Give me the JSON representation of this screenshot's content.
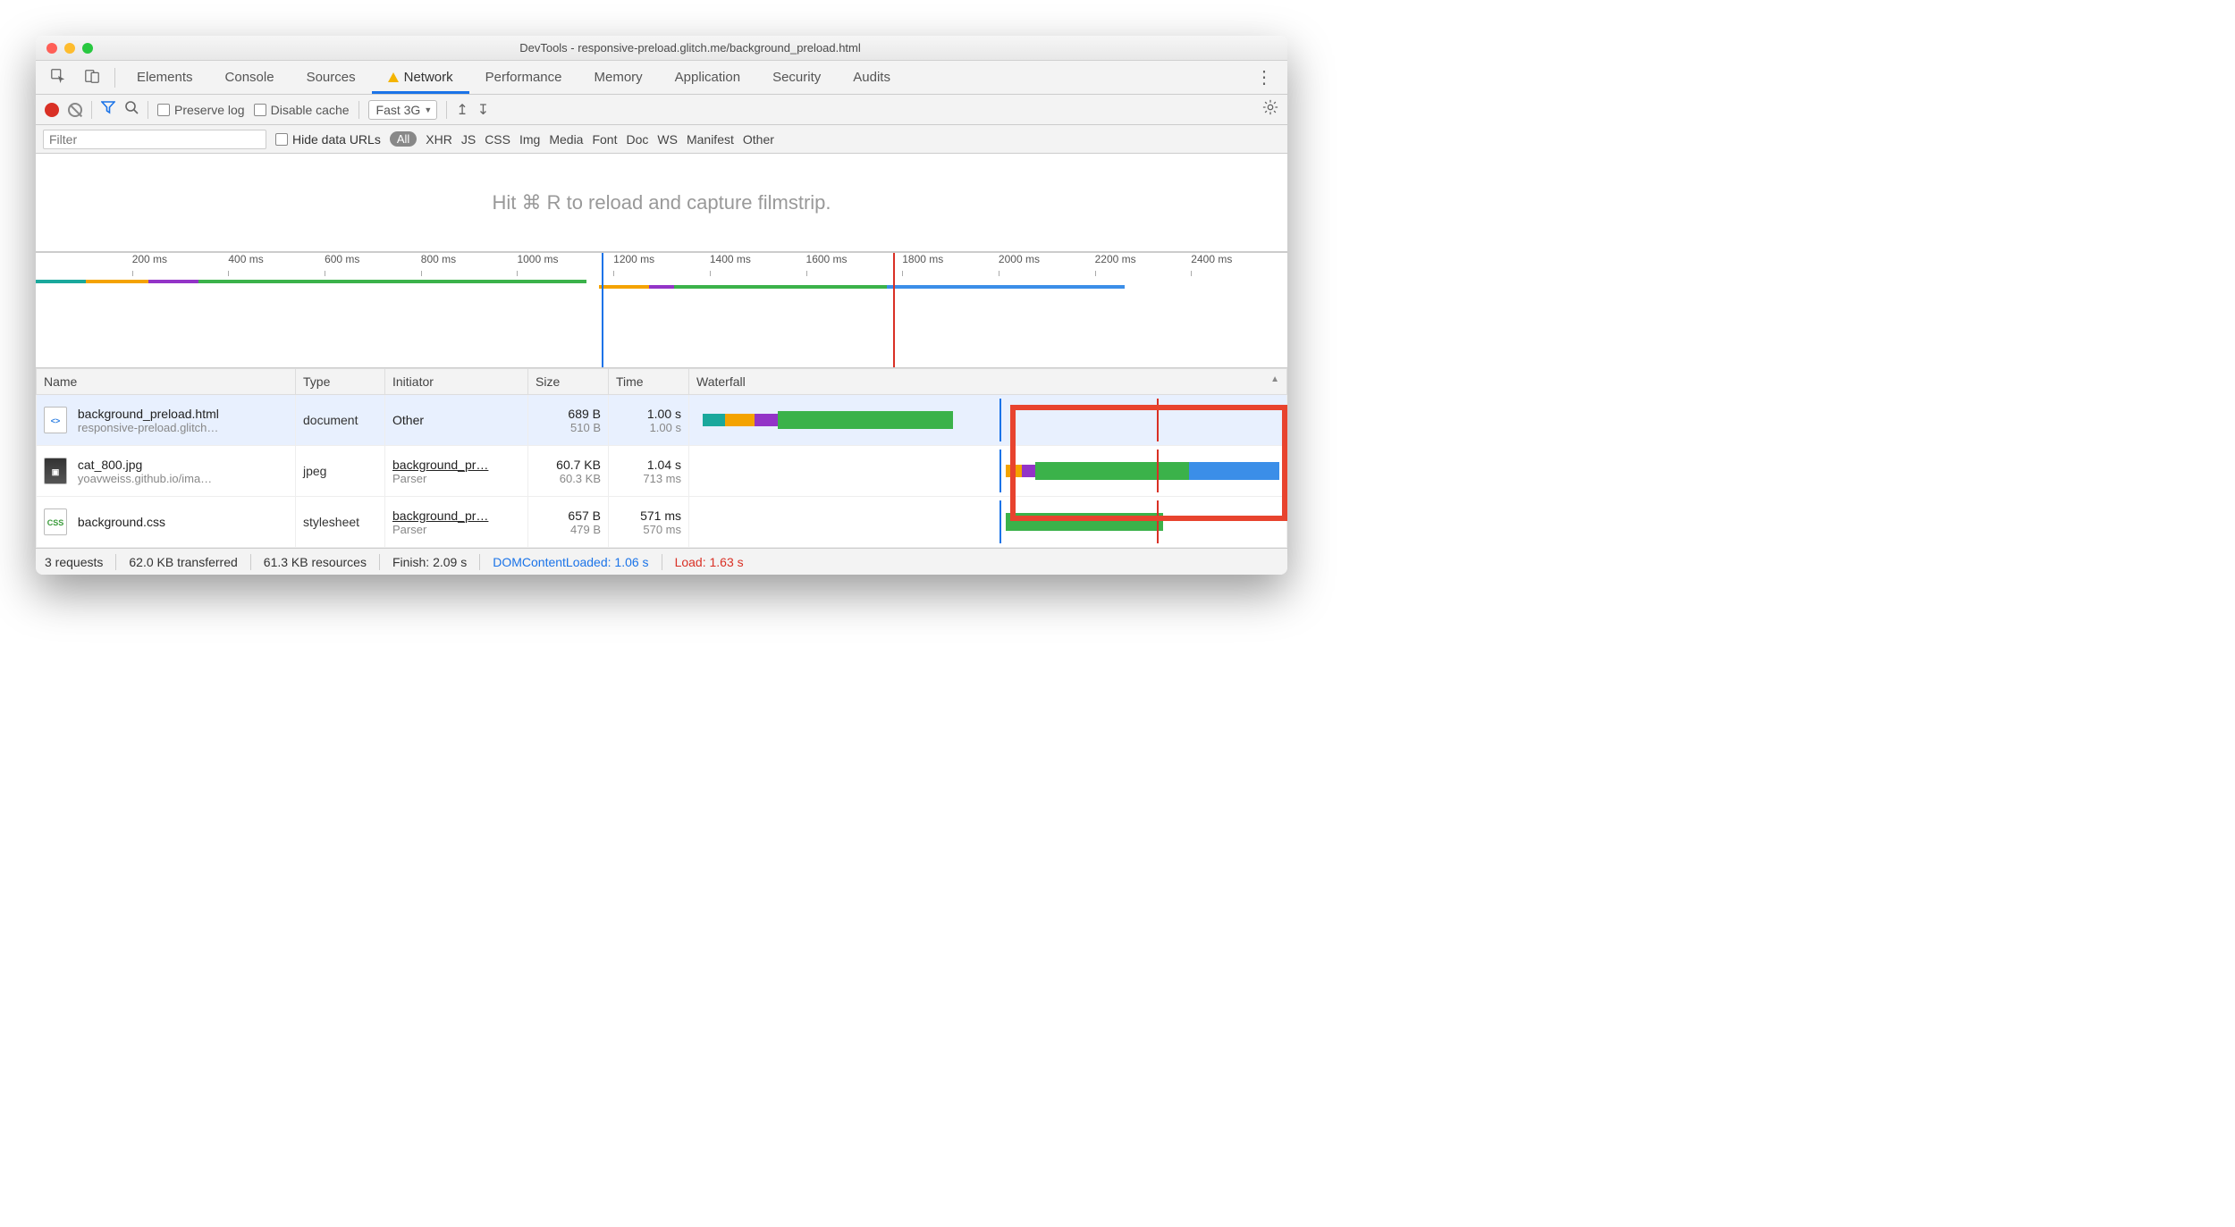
{
  "window": {
    "title": "DevTools - responsive-preload.glitch.me/background_preload.html"
  },
  "tabs": {
    "elements": "Elements",
    "console": "Console",
    "sources": "Sources",
    "network": "Network",
    "performance": "Performance",
    "memory": "Memory",
    "application": "Application",
    "security": "Security",
    "audits": "Audits"
  },
  "toolbar": {
    "preserve_log": "Preserve log",
    "disable_cache": "Disable cache",
    "throttle": "Fast 3G"
  },
  "filterbar": {
    "filter_placeholder": "Filter",
    "hide_urls": "Hide data URLs",
    "all": "All",
    "types": [
      "XHR",
      "JS",
      "CSS",
      "Img",
      "Media",
      "Font",
      "Doc",
      "WS",
      "Manifest",
      "Other"
    ]
  },
  "filmstrip": {
    "message": "Hit ⌘ R to reload and capture filmstrip."
  },
  "ruler": {
    "ticks": [
      "200 ms",
      "400 ms",
      "600 ms",
      "800 ms",
      "1000 ms",
      "1200 ms",
      "1400 ms",
      "1600 ms",
      "1800 ms",
      "2000 ms",
      "2200 ms",
      "2400 ms"
    ]
  },
  "columns": {
    "name": "Name",
    "type": "Type",
    "initiator": "Initiator",
    "size": "Size",
    "time": "Time",
    "waterfall": "Waterfall"
  },
  "rows": [
    {
      "name": "background_preload.html",
      "sub": "responsive-preload.glitch…",
      "type": "document",
      "initiator": "Other",
      "initiator_sub": "",
      "size": "689 B",
      "size_sub": "510 B",
      "time": "1.00 s",
      "time_sub": "1.00 s"
    },
    {
      "name": "cat_800.jpg",
      "sub": "yoavweiss.github.io/ima…",
      "type": "jpeg",
      "initiator": "background_pr…",
      "initiator_sub": "Parser",
      "size": "60.7 KB",
      "size_sub": "60.3 KB",
      "time": "1.04 s",
      "time_sub": "713 ms"
    },
    {
      "name": "background.css",
      "sub": "",
      "type": "stylesheet",
      "initiator": "background_pr…",
      "initiator_sub": "Parser",
      "size": "657 B",
      "size_sub": "479 B",
      "time": "571 ms",
      "time_sub": "570 ms"
    }
  ],
  "status": {
    "requests": "3 requests",
    "transferred": "62.0 KB transferred",
    "resources": "61.3 KB resources",
    "finish": "Finish: 2.09 s",
    "dcl": "DOMContentLoaded: 1.06 s",
    "load": "Load: 1.63 s"
  }
}
